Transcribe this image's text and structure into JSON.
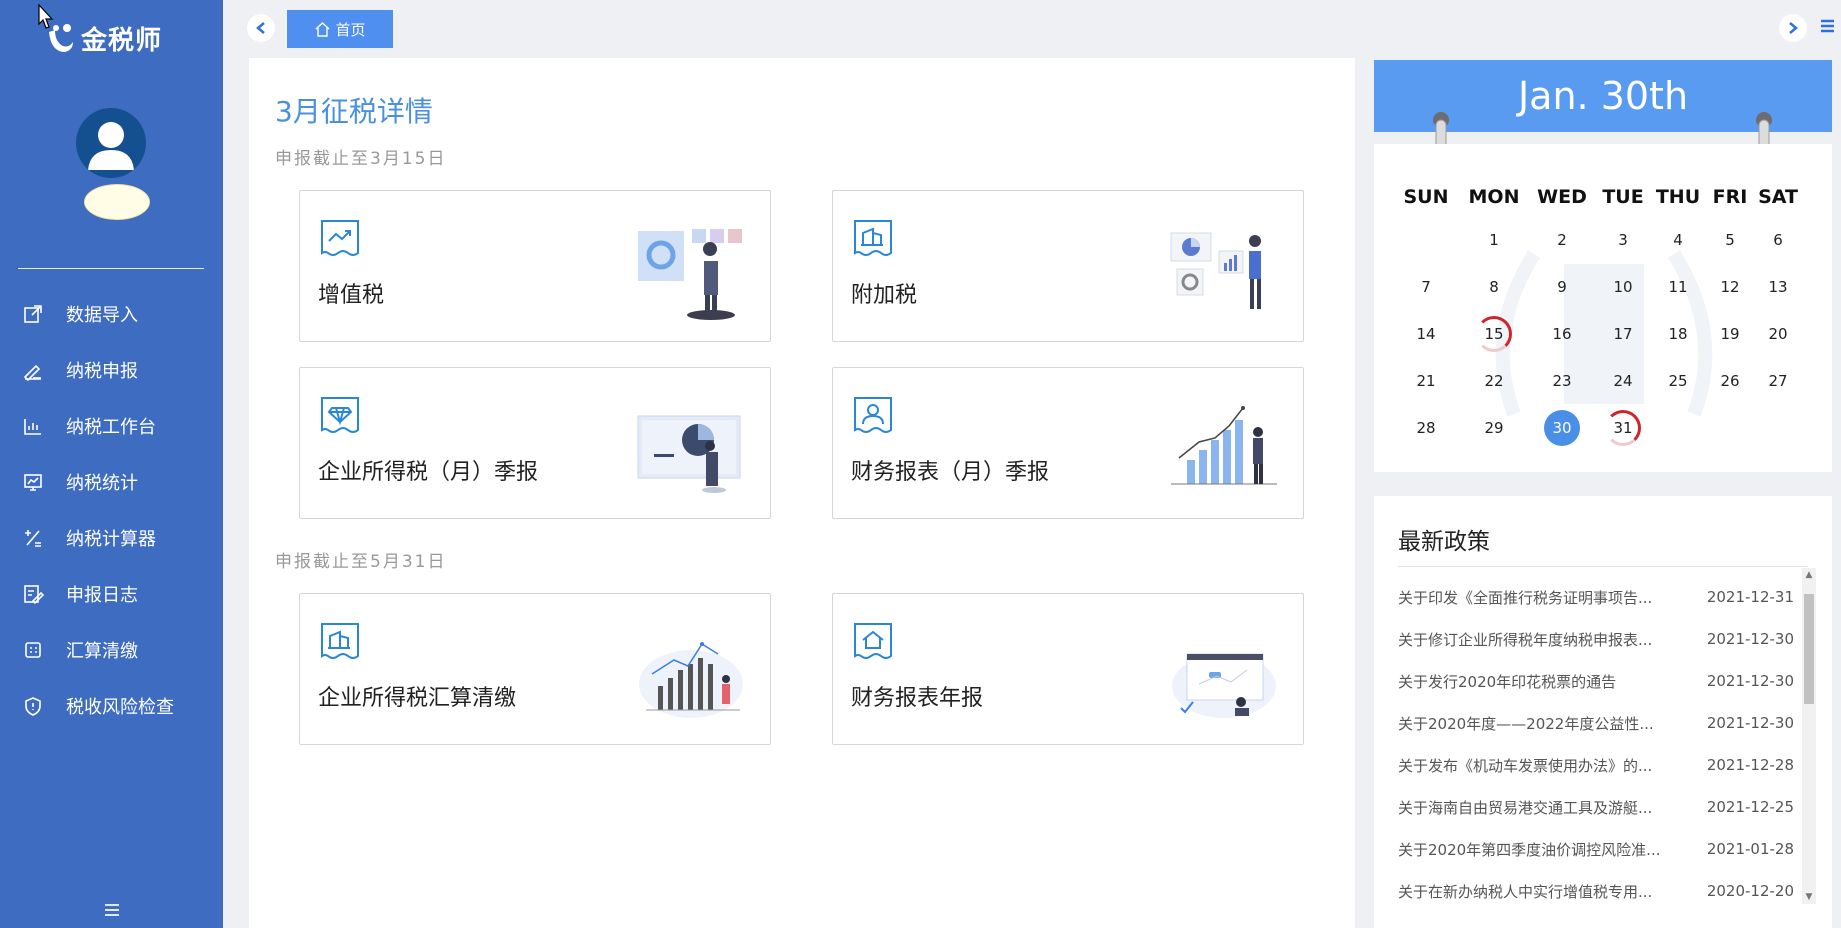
{
  "app": {
    "brand_text": "金税师"
  },
  "sidebar": {
    "items": [
      {
        "label": "数据导入",
        "icon": "import-icon"
      },
      {
        "label": "纳税申报",
        "icon": "edit-pen-icon"
      },
      {
        "label": "纳税工作台",
        "icon": "bar-chart-icon"
      },
      {
        "label": "纳税统计",
        "icon": "monitor-chart-icon"
      },
      {
        "label": "纳税计算器",
        "icon": "calculator-icon"
      },
      {
        "label": "申报日志",
        "icon": "log-icon"
      },
      {
        "label": "汇算清缴",
        "icon": "grid-icon"
      },
      {
        "label": "税收风险检查",
        "icon": "shield-icon"
      }
    ]
  },
  "topbar": {
    "home_tab": "首页"
  },
  "main": {
    "title": "3月征税详情",
    "section1_deadline": "申报截止至3月15日",
    "section2_deadline": "申报截止至5月31日",
    "cards": [
      {
        "label": "增值税",
        "icon": "trend-doc-icon"
      },
      {
        "label": "附加税",
        "icon": "building-doc-icon"
      },
      {
        "label": "企业所得税（月）季报",
        "icon": "diamond-doc-icon"
      },
      {
        "label": "财务报表（月）季报",
        "icon": "person-doc-icon"
      },
      {
        "label": "企业所得税汇算清缴",
        "icon": "building-doc-icon"
      },
      {
        "label": "财务报表年报",
        "icon": "house-doc-icon"
      }
    ]
  },
  "calendar": {
    "header": "Jan. 30th",
    "weekdays": [
      "SUN",
      "MON",
      "WED",
      "TUE",
      "THU",
      "FRI",
      "SAT"
    ],
    "weeks": [
      [
        "",
        "1",
        "2",
        "3",
        "4",
        "5",
        "6"
      ],
      [
        "7",
        "8",
        "9",
        "10",
        "11",
        "12",
        "13"
      ],
      [
        "14",
        "15",
        "16",
        "17",
        "18",
        "19",
        "20"
      ],
      [
        "21",
        "22",
        "23",
        "24",
        "25",
        "26",
        "27"
      ],
      [
        "28",
        "29",
        "30",
        "31",
        "",
        "",
        ""
      ]
    ],
    "marked_days": [
      "15",
      "31"
    ],
    "today": "30"
  },
  "policy": {
    "title": "最新政策",
    "items": [
      {
        "text": "关于印发《全面推行税务证明事项告...",
        "date": "2021-12-31"
      },
      {
        "text": "关于修订企业所得税年度纳税申报表...",
        "date": "2021-12-30"
      },
      {
        "text": "关于发行2020年印花税票的通告",
        "date": "2021-12-30"
      },
      {
        "text": "关于2020年度——2022年度公益性...",
        "date": "2021-12-30"
      },
      {
        "text": "关于发布《机动车发票使用办法》的...",
        "date": "2021-12-28"
      },
      {
        "text": "关于海南自由贸易港交通工具及游艇...",
        "date": "2021-12-25"
      },
      {
        "text": "关于2020年第四季度油价调控风险准...",
        "date": "2021-01-28"
      },
      {
        "text": "关于在新办纳税人中实行增值税专用...",
        "date": "2020-12-20"
      }
    ]
  },
  "colors": {
    "sidebar": "#3d6cc1",
    "accent": "#4a8fe7",
    "calendar_header": "#5a9bf2",
    "marker": "#d0232a"
  }
}
